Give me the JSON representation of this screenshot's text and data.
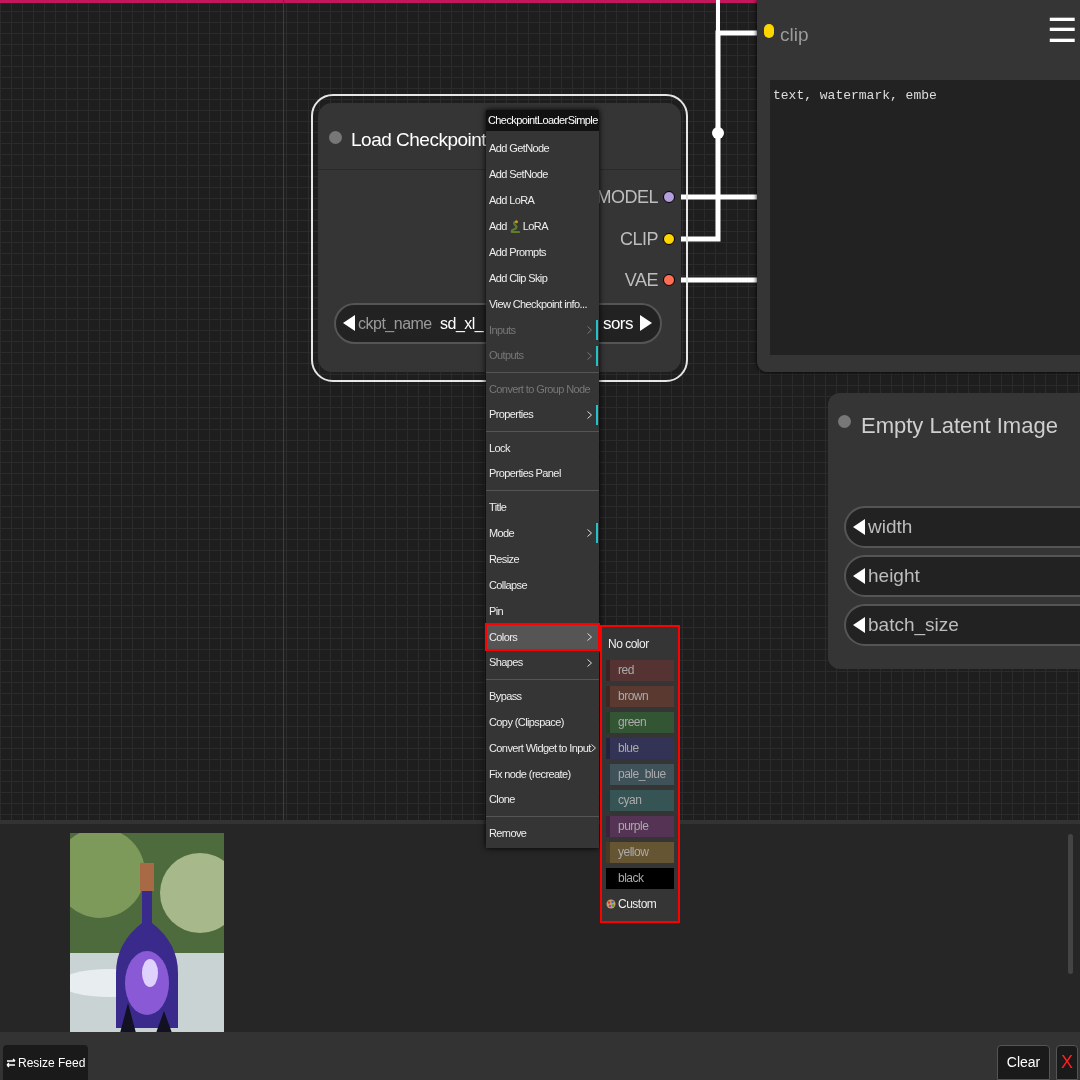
{
  "load_checkpoint_node": {
    "title": "Load Checkpoint",
    "outputs": [
      {
        "label": "MODEL",
        "color": "#b39ddb"
      },
      {
        "label": "CLIP",
        "color": "#ffd500"
      },
      {
        "label": "VAE",
        "color": "#ff6e54"
      }
    ],
    "widget": {
      "label": "ckpt_name",
      "value_start": "sd_xl_",
      "value_end": "sors"
    }
  },
  "text_node": {
    "input_label": "clip",
    "menu_glyph": "☰",
    "text": "text, watermark, embe"
  },
  "latent_node": {
    "title": "Empty Latent Image",
    "widgets": [
      "width",
      "height",
      "batch_size"
    ]
  },
  "context_menu": [
    {
      "label": "CheckpointLoaderSimple",
      "kind": "title"
    },
    {
      "label": "Add GetNode",
      "kind": "action",
      "disabled": false
    },
    {
      "label": "Add SetNode",
      "kind": "action",
      "disabled": false
    },
    {
      "label": "Add LoRA",
      "kind": "action",
      "disabled": false
    },
    {
      "label_before": "Add",
      "label_after": "LoRA",
      "kind": "icon_action",
      "disabled": false
    },
    {
      "label": "Add Prompts",
      "kind": "action",
      "disabled": false
    },
    {
      "label": "Add Clip Skip",
      "kind": "action",
      "disabled": false
    },
    {
      "label": "View Checkpoint info...",
      "kind": "action",
      "disabled": false
    },
    {
      "label": "Inputs",
      "kind": "submenu",
      "disabled": true,
      "accent": true
    },
    {
      "label": "Outputs",
      "kind": "submenu",
      "disabled": true,
      "accent": true,
      "separator_after": true
    },
    {
      "label": "Convert to Group Node",
      "kind": "action",
      "disabled": true
    },
    {
      "label": "Properties",
      "kind": "submenu",
      "disabled": false,
      "accent": true,
      "separator_after": true
    },
    {
      "label": "Lock",
      "kind": "action",
      "disabled": false
    },
    {
      "label": "Properties Panel",
      "kind": "action",
      "disabled": false,
      "separator_after": true
    },
    {
      "label": "Title",
      "kind": "action",
      "disabled": false
    },
    {
      "label": "Mode",
      "kind": "submenu",
      "disabled": false,
      "accent": true
    },
    {
      "label": "Resize",
      "kind": "action",
      "disabled": false
    },
    {
      "label": "Collapse",
      "kind": "action",
      "disabled": false
    },
    {
      "label": "Pin",
      "kind": "action",
      "disabled": false
    },
    {
      "label": "Colors",
      "kind": "submenu",
      "disabled": false,
      "accent": false,
      "selected": true
    },
    {
      "label": "Shapes",
      "kind": "submenu",
      "disabled": false,
      "accent": false,
      "separator_after": true
    },
    {
      "label": "Bypass",
      "kind": "action",
      "disabled": false
    },
    {
      "label": "Copy (Clipspace)",
      "kind": "action",
      "disabled": false
    },
    {
      "label": "Convert Widget to Input",
      "kind": "submenu",
      "disabled": false,
      "accent": false
    },
    {
      "label": "Fix node (recreate)",
      "kind": "action",
      "disabled": false
    },
    {
      "label": "Clone",
      "kind": "action",
      "disabled": false,
      "separator_after": true
    },
    {
      "label": "Remove",
      "kind": "action",
      "disabled": false
    }
  ],
  "colors_submenu": [
    {
      "label": "No color",
      "kind": "none"
    },
    {
      "label": "red",
      "kind": "swatch",
      "color": "#553333"
    },
    {
      "label": "brown",
      "kind": "swatch",
      "color": "#593930"
    },
    {
      "label": "green",
      "kind": "swatch",
      "color": "#335533"
    },
    {
      "label": "blue",
      "kind": "swatch",
      "color": "#333355"
    },
    {
      "label": "pale_blue",
      "kind": "swatch",
      "color": "#3f5159"
    },
    {
      "label": "cyan",
      "kind": "swatch",
      "color": "#365454"
    },
    {
      "label": "purple",
      "kind": "swatch",
      "color": "#553355"
    },
    {
      "label": "yellow",
      "kind": "swatch",
      "color": "#665533"
    },
    {
      "label": "black",
      "kind": "swatch",
      "color": "#000000"
    },
    {
      "label": "Custom",
      "kind": "custom"
    }
  ],
  "bottom_bar": {
    "resize_button": "Resize Feed",
    "clear_button": "Clear",
    "close_button": "X"
  }
}
